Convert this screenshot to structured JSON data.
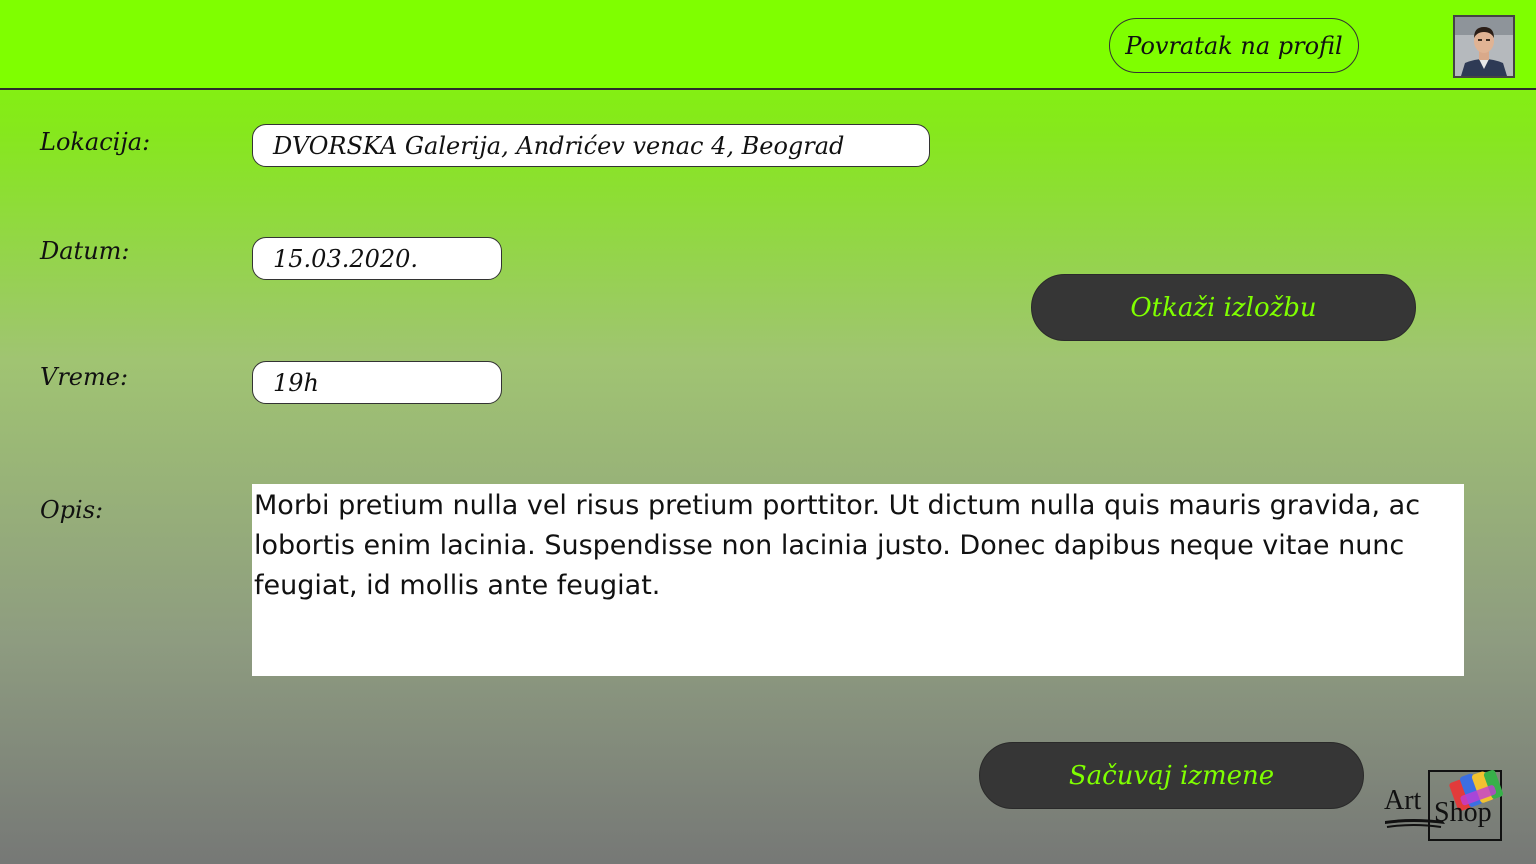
{
  "header": {
    "back_button_label": "Povratak na profil"
  },
  "form": {
    "location": {
      "label": "Lokacija:",
      "value": "DVORSKA Galerija, Andrićev venac 4, Beograd"
    },
    "date": {
      "label": "Datum:",
      "value": "15.03.2020."
    },
    "time": {
      "label": "Vreme:",
      "value": "19h"
    },
    "description": {
      "label": "Opis:",
      "value": "Morbi pretium nulla vel risus pretium porttitor. Ut dictum nulla quis mauris gravida, ac lobortis enim lacinia. Suspendisse non lacinia justo. Donec dapibus neque vitae nunc feugiat, id mollis ante feugiat."
    }
  },
  "actions": {
    "cancel_label": "Otkaži izložbu",
    "save_label": "Sačuvaj izmene"
  },
  "logo": {
    "line1": "Art",
    "line2": "Shop"
  },
  "colors": {
    "accent": "#7fff00",
    "button_dark": "#363636"
  }
}
